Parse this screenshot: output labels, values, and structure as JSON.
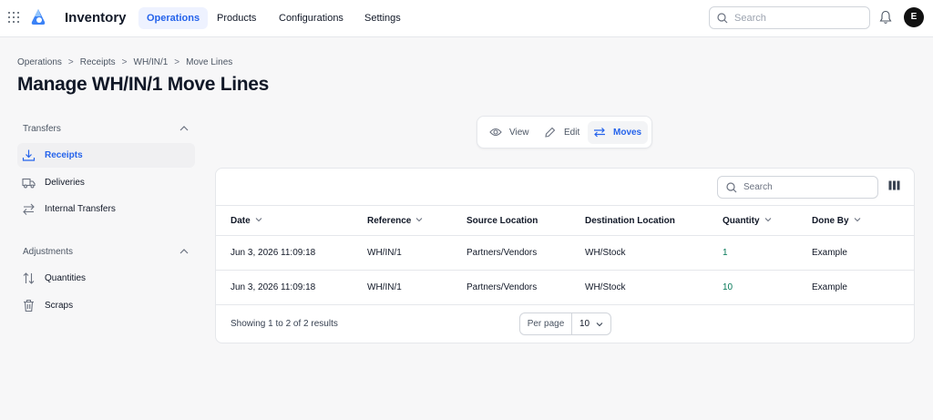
{
  "app": {
    "name": "Inventory",
    "avatar_initial": "E"
  },
  "nav": {
    "items": [
      {
        "label": "Operations",
        "active": true
      },
      {
        "label": "Products",
        "active": false
      },
      {
        "label": "Configurations",
        "active": false
      },
      {
        "label": "Settings",
        "active": false
      }
    ],
    "search_placeholder": "Search"
  },
  "breadcrumb": [
    "Operations",
    "Receipts",
    "WH/IN/1",
    "Move Lines"
  ],
  "page": {
    "title": "Manage WH/IN/1 Move Lines"
  },
  "sidebar": {
    "groups": [
      {
        "title": "Transfers",
        "items": [
          {
            "label": "Receipts",
            "icon": "download-icon",
            "active": true
          },
          {
            "label": "Deliveries",
            "icon": "truck-icon",
            "active": false
          },
          {
            "label": "Internal Transfers",
            "icon": "arrows-left-right-icon",
            "active": false
          }
        ]
      },
      {
        "title": "Adjustments",
        "items": [
          {
            "label": "Quantities",
            "icon": "arrows-up-down-icon",
            "active": false
          },
          {
            "label": "Scraps",
            "icon": "trash-icon",
            "active": false
          }
        ]
      }
    ]
  },
  "view_switcher": [
    {
      "label": "View",
      "icon": "eye-icon",
      "active": false
    },
    {
      "label": "Edit",
      "icon": "pencil-icon",
      "active": false
    },
    {
      "label": "Moves",
      "icon": "swap-icon",
      "active": true
    }
  ],
  "table": {
    "search_placeholder": "Search",
    "columns": [
      {
        "label": "Date",
        "sortable": true
      },
      {
        "label": "Reference",
        "sortable": true
      },
      {
        "label": "Source Location",
        "sortable": false
      },
      {
        "label": "Destination Location",
        "sortable": false
      },
      {
        "label": "Quantity",
        "sortable": true
      },
      {
        "label": "Done By",
        "sortable": true
      }
    ],
    "rows": [
      [
        "Jun 3, 2026 11:09:18",
        "WH/IN/1",
        "Partners/Vendors",
        "WH/Stock",
        "1",
        "Example"
      ],
      [
        "Jun 3, 2026 11:09:18",
        "WH/IN/1",
        "Partners/Vendors",
        "WH/Stock",
        "10",
        "Example"
      ]
    ],
    "footer": {
      "summary": "Showing 1 to 2 of 2 results",
      "per_page_label": "Per page",
      "per_page_value": "10"
    }
  },
  "colors": {
    "accent": "#2563eb",
    "quantity": "#047857"
  }
}
